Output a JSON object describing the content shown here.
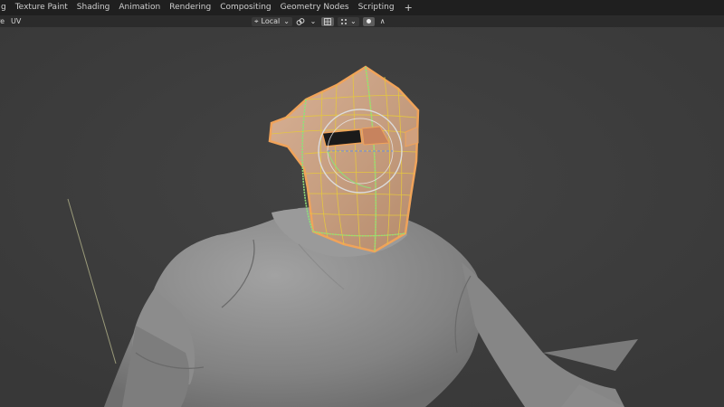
{
  "topbar": {
    "tabs": [
      {
        "label": "g",
        "name": "tab-modeling-partial"
      },
      {
        "label": "Texture Paint",
        "name": "tab-texture-paint"
      },
      {
        "label": "Shading",
        "name": "tab-shading"
      },
      {
        "label": "Animation",
        "name": "tab-animation"
      },
      {
        "label": "Rendering",
        "name": "tab-rendering"
      },
      {
        "label": "Compositing",
        "name": "tab-compositing"
      },
      {
        "label": "Geometry Nodes",
        "name": "tab-geometry-nodes"
      },
      {
        "label": "Scripting",
        "name": "tab-scripting"
      }
    ],
    "add_label": "+"
  },
  "header": {
    "left_items": [
      "re",
      "UV"
    ],
    "pivot_icon": "⌖",
    "transform_orientation": "Local",
    "chevron": "⌄",
    "snap_icon": "🔗",
    "proportional_icon": "◉",
    "falloff_icon": "∧"
  },
  "colors": {
    "background": "#3d3d3d",
    "topbar": "#1f1f1f",
    "header": "#2b2b2b",
    "mesh_fill": "#c9a082",
    "mesh_edge": "#f0a35a",
    "seam": "#8fe07a",
    "body": "#8a8a8a"
  },
  "icons": [
    "pivot-icon",
    "link-snap-icon",
    "proportional-edit-icon",
    "falloff-icon",
    "chevron-down-icon"
  ]
}
